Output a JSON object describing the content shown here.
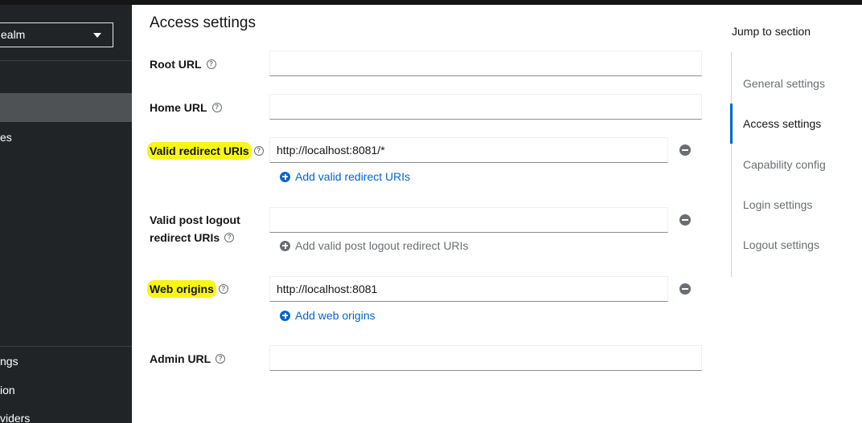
{
  "sidebar": {
    "realm_label": "ealm",
    "items": [
      {
        "label": ""
      },
      {
        "label": "es"
      }
    ],
    "bottom_items": [
      {
        "label": "ngs"
      },
      {
        "label": "ion"
      },
      {
        "label": "viders"
      }
    ]
  },
  "section": {
    "title": "Access settings"
  },
  "fields": {
    "root_url": {
      "label": "Root URL",
      "value": ""
    },
    "home_url": {
      "label": "Home URL",
      "value": ""
    },
    "valid_redirect_uris": {
      "label": "Valid redirect URIs",
      "value": "http://localhost:8081/*",
      "add_label": "Add valid redirect URIs"
    },
    "valid_post_logout": {
      "label_line1": "Valid post logout",
      "label_line2": "redirect URIs",
      "value": "",
      "add_label": "Add valid post logout redirect URIs"
    },
    "web_origins": {
      "label": "Web origins",
      "value": "http://localhost:8081",
      "add_label": "Add web origins"
    },
    "admin_url": {
      "label": "Admin URL",
      "value": ""
    }
  },
  "jump": {
    "title": "Jump to section",
    "items": [
      {
        "label": "General settings"
      },
      {
        "label": "Access settings"
      },
      {
        "label": "Capability config"
      },
      {
        "label": "Login settings"
      },
      {
        "label": "Logout settings"
      }
    ],
    "active": "Access settings"
  },
  "colors": {
    "link": "#0066cc",
    "highlight": "#f7f516",
    "sidebar_bg": "#212427"
  }
}
